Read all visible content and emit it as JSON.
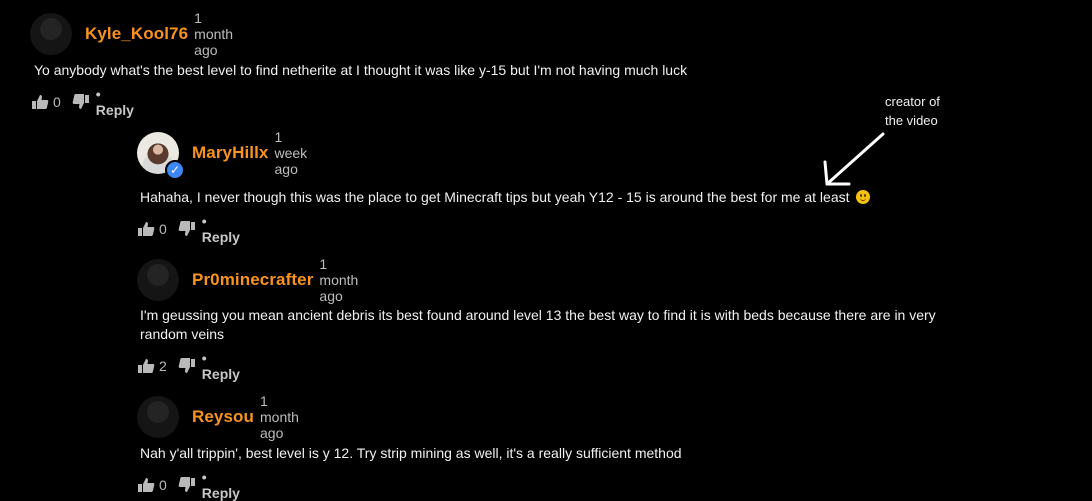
{
  "comments": [
    {
      "author": "Kyle_Kool76",
      "time": "1 month ago",
      "text": "Yo anybody what's the best level to find netherite at I thought it was like y-15 but I'm not having much luck",
      "likes": "0",
      "reply_label": "• Reply",
      "avatar_type": "default",
      "verified": false
    },
    {
      "author": "MaryHillx",
      "time": "1 week ago",
      "text": "Hahaha, I never though this was the place to get Minecraft tips but yeah Y12 - 15 is around the best for me at least",
      "likes": "0",
      "reply_label": "• Reply",
      "avatar_type": "photo",
      "verified": true,
      "emoji": "smiling-face-icon"
    },
    {
      "author": "Pr0minecrafter",
      "time": "1 month ago",
      "text": "I'm geussing you mean ancient debris its best found around level 13 the best way to find it is with beds because there are in very random veins",
      "likes": "2",
      "reply_label": "• Reply",
      "avatar_type": "default",
      "verified": false
    },
    {
      "author": "Reysou",
      "time": "1 month ago",
      "text": "Nah y'all trippin', best level is y 12. Try strip mining as well, it's a really sufficient method",
      "likes": "0",
      "reply_label": "• Reply",
      "avatar_type": "default",
      "verified": false
    }
  ],
  "annotation": {
    "text_line1": "creator of",
    "text_line2": "the video"
  },
  "icons": {
    "like": "thumbs-up-icon",
    "dislike": "thumbs-down-icon",
    "verified": "verified-check-icon"
  },
  "colors": {
    "background": "#000000",
    "author": "#f7931e",
    "verified": "#3f87f5"
  }
}
